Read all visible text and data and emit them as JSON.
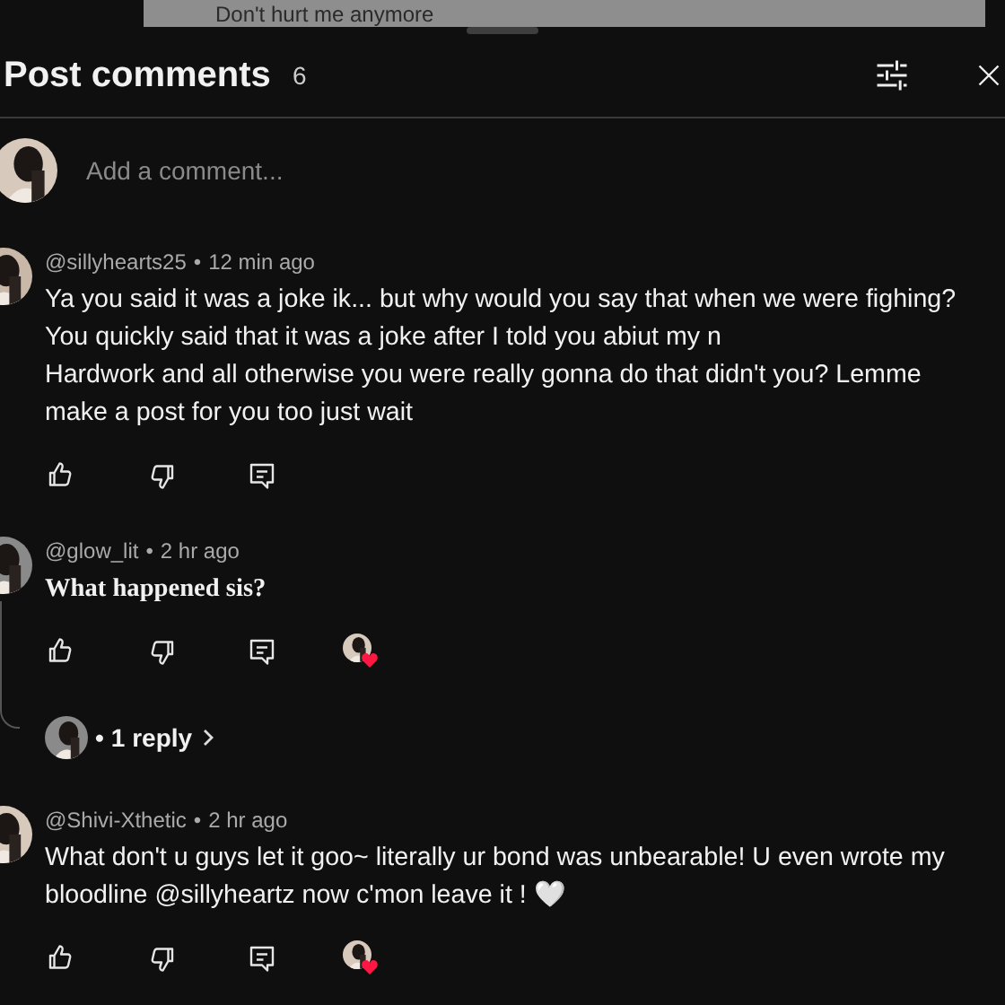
{
  "peek": {
    "text": "Don't hurt me anymore"
  },
  "header": {
    "title": "Post comments",
    "count": "6"
  },
  "composer": {
    "placeholder": "Add a comment..."
  },
  "comments": [
    {
      "author": "@sillyhearts25",
      "sep": "•",
      "time": "12 min ago",
      "kind": "plain",
      "text": "Ya you said it was a joke ik... but why would you say that when we were fighing?\nYou quickly said that it was a joke after I told you abiut my n\nHardwork and all otherwise you were really gonna do that didn't you? Lemme make a post for you too just wait",
      "hearted": false
    },
    {
      "author": "@glow_lit",
      "sep": "•",
      "time": "2 hr ago",
      "kind": "styled",
      "text": "What happened sis?",
      "hearted": true,
      "replies": {
        "dot": "•",
        "label": "1 reply"
      }
    },
    {
      "author": "@Shivi-Xthetic",
      "sep": "•",
      "time": "2 hr ago",
      "kind": "plain",
      "text": "What don't u guys let it goo~ literally ur bond was unbearable! U even wrote my bloodline @sillyheartz now c'mon leave it ! 🤍",
      "hearted": true
    }
  ]
}
